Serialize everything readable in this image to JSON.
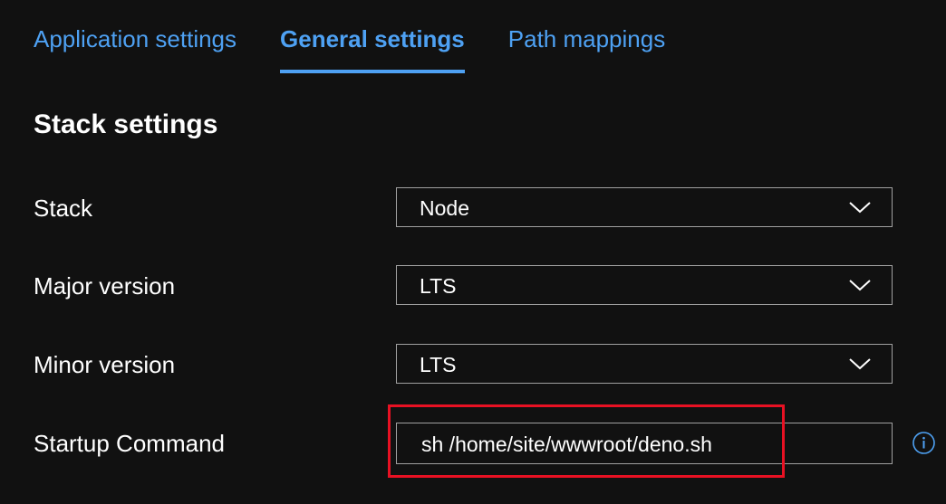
{
  "tabs": {
    "application_settings": "Application settings",
    "general_settings": "General settings",
    "path_mappings": "Path mappings",
    "active": "general_settings"
  },
  "section": {
    "title": "Stack settings"
  },
  "fields": {
    "stack": {
      "label": "Stack",
      "value": "Node"
    },
    "major_version": {
      "label": "Major version",
      "value": "LTS"
    },
    "minor_version": {
      "label": "Minor version",
      "value": "LTS"
    },
    "startup_command": {
      "label": "Startup Command",
      "value": "sh /home/site/wwwroot/deno.sh"
    }
  },
  "icons": {
    "dropdown": "chevron-down-icon",
    "info": "info-icon"
  },
  "colors": {
    "background": "#111111",
    "accent": "#4ea1f3",
    "highlight": "#e81123",
    "border": "#a0a0a0"
  }
}
